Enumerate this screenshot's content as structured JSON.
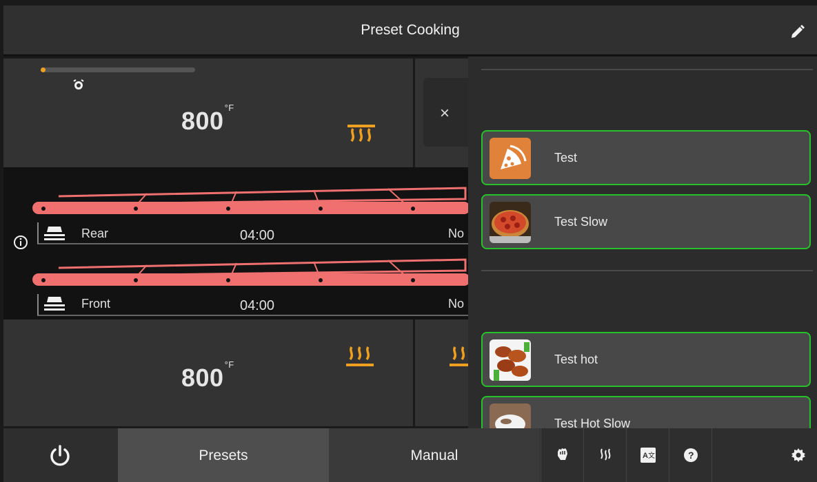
{
  "header": {
    "title": "Preset Cooking",
    "edit_icon": "pencil-icon"
  },
  "oven": {
    "top_zone": {
      "temperature": "800",
      "unit": "°F",
      "progress": 0.03,
      "heat_icon": "top-heat-icon",
      "status_icon": "alarm-clock-icon"
    },
    "bottom_zone": {
      "temperature": "800",
      "unit": "°F",
      "heat_icon": "bottom-heat-icon"
    },
    "belts": [
      {
        "name": "Rear",
        "time": "04:00",
        "status": "No"
      },
      {
        "name": "Front",
        "time": "04:00",
        "status": "No"
      }
    ]
  },
  "drawer": {
    "close_label": "×",
    "presets": [
      {
        "label": "Test",
        "thumb": "pizza-slice-icon"
      },
      {
        "label": "Test Slow",
        "thumb": "pizza-photo"
      },
      {
        "label": "Test hot",
        "thumb": "chicken-wings-photo"
      },
      {
        "label": "Test Hot Slow",
        "thumb": "plate-icon"
      }
    ]
  },
  "footer": {
    "tabs": {
      "presets": "Presets",
      "manual": "Manual"
    },
    "tools": [
      "hand-icon",
      "steam-icon",
      "translate-icon",
      "help-icon",
      "settings-gear-icon"
    ]
  },
  "colors": {
    "accent": "#f0a020",
    "preset_border": "#27c22a",
    "belt": "#f07070"
  }
}
